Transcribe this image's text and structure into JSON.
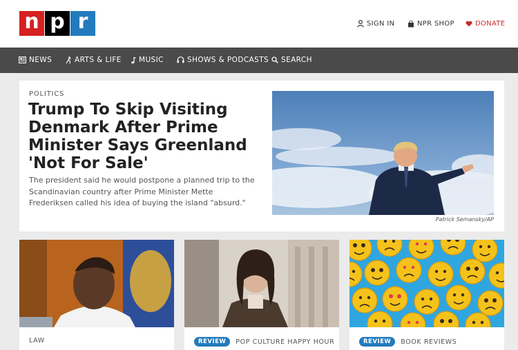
{
  "header": {
    "logo": [
      "n",
      "p",
      "r"
    ],
    "signin_label": "SIGN IN",
    "shop_label": "NPR SHOP",
    "donate_label": "DONATE"
  },
  "nav": {
    "items": [
      {
        "label": "NEWS",
        "icon": "news-icon"
      },
      {
        "label": "ARTS & LIFE",
        "icon": "arts-icon"
      },
      {
        "label": "MUSIC",
        "icon": "music-icon"
      },
      {
        "label": "SHOWS & PODCASTS",
        "icon": "headphones-icon"
      },
      {
        "label": "SEARCH",
        "icon": "search-icon"
      }
    ]
  },
  "featured": {
    "kicker": "POLITICS",
    "headline": "Trump To Skip Visiting Denmark After Prime Minister Says Greenland 'Not For Sale'",
    "teaser": "The president said he would postpone a planned trip to the Scandinavian country after Prime Minister Mette Frederiksen called his idea of buying the island \"absurd.\"",
    "credit": "Patrick Semansky/AP"
  },
  "cards": [
    {
      "kicker": "LAW",
      "badge": ""
    },
    {
      "kicker": "POP CULTURE HAPPY HOUR",
      "badge": "REVIEW"
    },
    {
      "kicker": "BOOK REVIEWS",
      "badge": "REVIEW"
    }
  ],
  "colors": {
    "npr_red": "#d62021",
    "npr_black": "#000000",
    "npr_blue": "#237bbd",
    "nav_bg": "#4a4a4a",
    "donate": "#c72c2c"
  }
}
